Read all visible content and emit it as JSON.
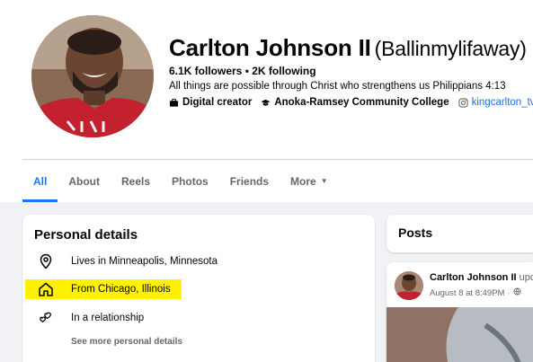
{
  "profile": {
    "name": "Carlton Johnson II",
    "alternate_name": "(Ballinmylifaway)",
    "followers": "6.1K followers",
    "separator": " • ",
    "following": "2K following",
    "bio": "All things are possible through Christ who strengthens us Philippians 4:13",
    "facts": [
      {
        "icon": "briefcase-icon",
        "text": "Digital creator"
      },
      {
        "icon": "graduation-cap-icon",
        "text": "Anoka-Ramsey Community College"
      },
      {
        "icon": "instagram-icon",
        "text": "kingcarlton_tv"
      }
    ]
  },
  "tabs": [
    {
      "label": "All",
      "active": true
    },
    {
      "label": "About"
    },
    {
      "label": "Reels"
    },
    {
      "label": "Photos"
    },
    {
      "label": "Friends"
    },
    {
      "label": "More",
      "icon": "caret-down-icon"
    }
  ],
  "personal_details": {
    "title": "Personal details",
    "items": [
      {
        "icon": "location-pin-icon",
        "text": "Lives in Minneapolis, Minnesota"
      },
      {
        "icon": "home-icon",
        "text": "From Chicago, Illinois",
        "highlighted": true
      },
      {
        "icon": "hearts-icon",
        "text": "In a relationship"
      }
    ],
    "see_more": "See more personal details"
  },
  "posts": {
    "title": "Posts",
    "post": {
      "author": "Carlton Johnson II",
      "action": " upd",
      "date": "August 8 at 8:49PM",
      "separator": " · ",
      "privacy_icon": "globe-icon"
    }
  },
  "colors": {
    "accent": "#1877f2",
    "highlight": "#fff200",
    "link": "#216fdb",
    "shirt": "#c4212f"
  }
}
